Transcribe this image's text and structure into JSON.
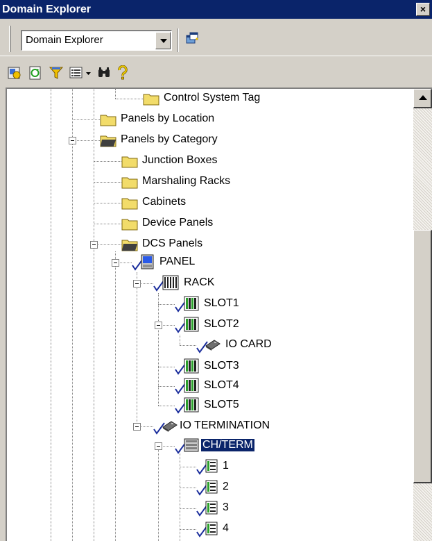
{
  "window": {
    "title": "Domain Explorer",
    "close_glyph": "×"
  },
  "toolbar": {
    "domain_combo_value": "Domain Explorer"
  },
  "tree": {
    "nodes": {
      "control_system_tag": "Control System Tag",
      "panels_by_location": "Panels by Location",
      "panels_by_category": "Panels by Category",
      "junction_boxes": "Junction Boxes",
      "marshaling_racks": "Marshaling Racks",
      "cabinets": "Cabinets",
      "device_panels": "Device Panels",
      "dcs_panels": "DCS Panels",
      "panel": "PANEL",
      "rack": "RACK",
      "slot1": "SLOT1",
      "slot2": "SLOT2",
      "io_card": "IO CARD",
      "slot3": "SLOT3",
      "slot4": "SLOT4",
      "slot5": "SLOT5",
      "io_termination": "IO TERMINATION",
      "ch_term": "CH/TERM",
      "ch1": "1",
      "ch2": "2",
      "ch3": "3",
      "ch4": "4"
    },
    "selected": "CH/TERM"
  },
  "colors": {
    "titlebar": "#0a246a",
    "folder": "#f2dc6a",
    "check": "#1a2d9c",
    "slot_green": "#2aa02a"
  }
}
